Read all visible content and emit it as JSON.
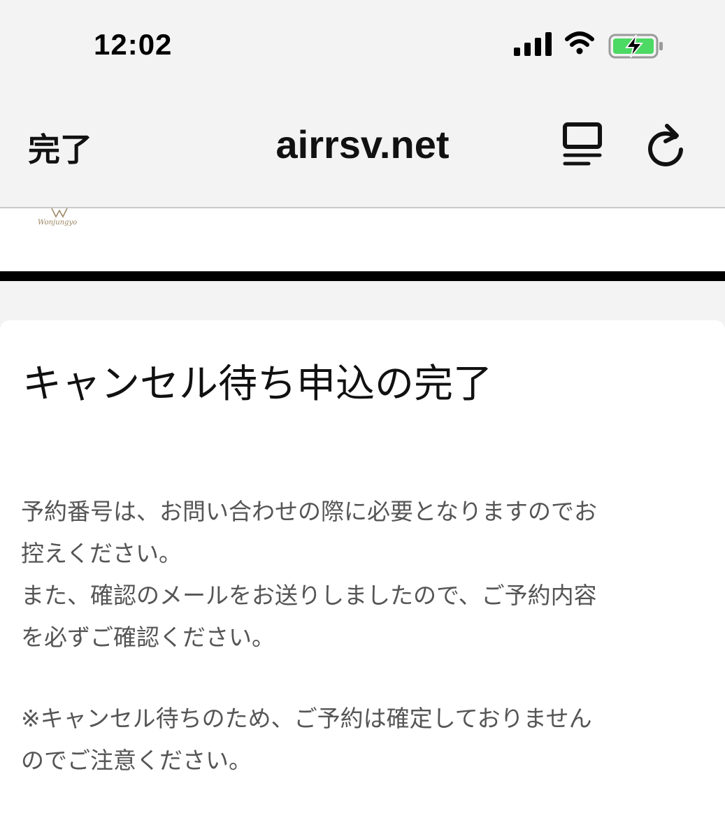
{
  "status_bar": {
    "time": "12:02"
  },
  "browser": {
    "done_label": "完了",
    "url": "airrsv.net"
  },
  "site": {
    "logo_text": "Wonjungyo"
  },
  "card": {
    "title": "キャンセル待ち申込の完了",
    "paragraph1_line1": "予約番号は、お問い合わせの際に必要となりますのでお",
    "paragraph1_line2": "控えください。",
    "paragraph1_line3": "また、確認のメールをお送りしましたので、ご予約内容",
    "paragraph1_line4": "を必ずご確認ください。",
    "note_line1": "※キャンセル待ちのため、ご予約は確定しておりません",
    "note_line2": "のでご注意ください。"
  },
  "colors": {
    "battery_green": "#4cd964",
    "chrome_bg": "#f3f3f3",
    "body_text": "#555555",
    "logo_gold": "#9a8460"
  },
  "icons": [
    "signal-icon",
    "wifi-icon",
    "battery-charging-icon",
    "reader-view-icon",
    "reload-icon"
  ]
}
